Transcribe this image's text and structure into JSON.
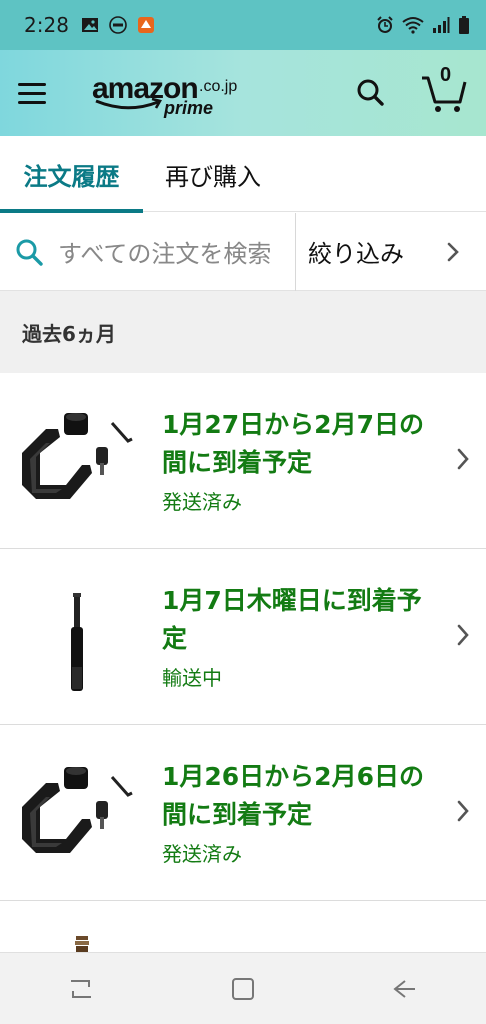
{
  "status_bar": {
    "time": "2:28",
    "left_icons": [
      "image-icon",
      "line-app-icon",
      "game-app-icon"
    ],
    "right_icons": [
      "alarm-icon",
      "wifi-icon",
      "signal-icon",
      "battery-icon"
    ]
  },
  "header": {
    "logo_word": "amazon",
    "logo_domain": ".co.jp",
    "logo_prime": "prime",
    "cart_count": "0"
  },
  "tabs": [
    {
      "label": "注文履歴",
      "active": true
    },
    {
      "label": "再び購入",
      "active": false
    }
  ],
  "search": {
    "placeholder": "すべての注文を検索",
    "filter_label": "絞り込み"
  },
  "section": {
    "title": "過去6ヵ月"
  },
  "orders": [
    {
      "title": "1月27日から2月7日の間に到着予定",
      "status": "発送済み",
      "thumb": "camera-cage"
    },
    {
      "title": "1月7日木曜日に到着予定",
      "status": "輸送中",
      "thumb": "selfie-stick"
    },
    {
      "title": "1月26日から2月6日の間に到着予定",
      "status": "発送済み",
      "thumb": "camera-cage"
    }
  ],
  "colors": {
    "status_bar": "#5ec3c3",
    "accent_teal": "#0b7a86",
    "order_green": "#137b13"
  }
}
